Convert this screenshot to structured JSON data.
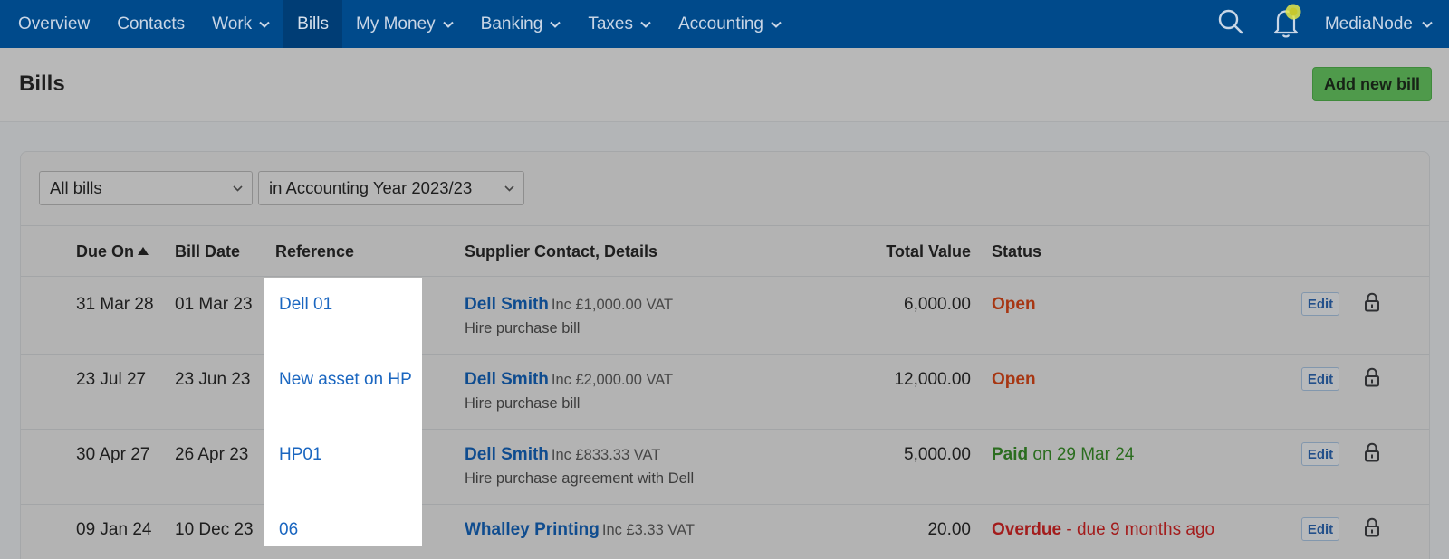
{
  "nav": {
    "items": [
      {
        "label": "Overview",
        "has_menu": false,
        "active": false
      },
      {
        "label": "Contacts",
        "has_menu": false,
        "active": false
      },
      {
        "label": "Work",
        "has_menu": true,
        "active": false
      },
      {
        "label": "Bills",
        "has_menu": false,
        "active": true
      },
      {
        "label": "My Money",
        "has_menu": true,
        "active": false
      },
      {
        "label": "Banking",
        "has_menu": true,
        "active": false
      },
      {
        "label": "Taxes",
        "has_menu": true,
        "active": false
      },
      {
        "label": "Accounting",
        "has_menu": true,
        "active": false
      }
    ],
    "user": "MediaNode",
    "colors": {
      "bar": "#004a8b",
      "active": "#003d75",
      "notification_dot": "#e3e64a"
    }
  },
  "header": {
    "title": "Bills",
    "add_button": "Add new bill"
  },
  "filters": {
    "type": "All bills",
    "period": "in Accounting Year 2023/23"
  },
  "table": {
    "columns": {
      "due_on": "Due On",
      "bill_date": "Bill Date",
      "reference": "Reference",
      "supplier": "Supplier Contact, Details",
      "total": "Total Value",
      "status": "Status"
    },
    "sort": {
      "column": "Due On",
      "direction": "ascending"
    },
    "edit_label": "Edit",
    "rows": [
      {
        "due_on": "31 Mar 28",
        "bill_date": "01 Mar 23",
        "reference": "Dell 01",
        "supplier": "Dell Smith",
        "vat": "Inc £1,000.00 VAT",
        "details": "Hire purchase bill",
        "total": "6,000.00",
        "status": "Open",
        "status_note": ""
      },
      {
        "due_on": "23 Jul 27",
        "bill_date": "23 Jun 23",
        "reference": "New asset on HP",
        "supplier": "Dell Smith",
        "vat": "Inc £2,000.00 VAT",
        "details": "Hire purchase bill",
        "total": "12,000.00",
        "status": "Open",
        "status_note": ""
      },
      {
        "due_on": "30 Apr 27",
        "bill_date": "26 Apr 23",
        "reference": "HP01",
        "supplier": "Dell Smith",
        "vat": "Inc £833.33 VAT",
        "details": "Hire purchase agreement with Dell",
        "total": "5,000.00",
        "status": "Paid",
        "status_note": "on 29 Mar 24"
      },
      {
        "due_on": "09 Jan 24",
        "bill_date": "10 Dec 23",
        "reference": "06",
        "supplier": "Whalley Printing",
        "vat": "Inc £3.33 VAT",
        "details": "",
        "total": "20.00",
        "status": "Overdue",
        "status_note": "- due 9 months ago"
      }
    ]
  }
}
